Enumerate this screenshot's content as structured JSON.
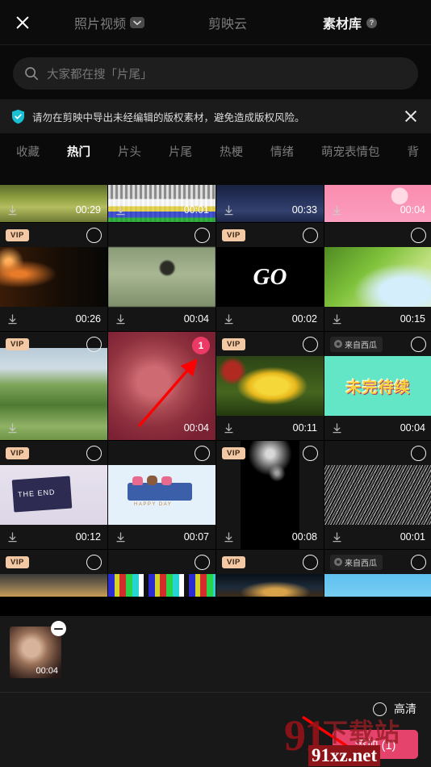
{
  "header": {
    "close_icon": "close-icon",
    "tabs": [
      {
        "label": "照片视频",
        "active": false,
        "has_chevron": true
      },
      {
        "label": "剪映云",
        "active": false,
        "has_chevron": false
      },
      {
        "label": "素材库",
        "active": true,
        "has_help": true,
        "help_glyph": "?"
      }
    ]
  },
  "search": {
    "placeholder": "大家都在搜「片尾」",
    "icon": "search-icon"
  },
  "banner": {
    "icon": "shield-check-icon",
    "text": "请勿在剪映中导出未经编辑的版权素材，避免造成版权风险。",
    "close_icon": "close-icon",
    "accent": "#19bfd3"
  },
  "categories": [
    {
      "label": "收藏",
      "active": false
    },
    {
      "label": "热门",
      "active": true
    },
    {
      "label": "片头",
      "active": false
    },
    {
      "label": "片尾",
      "active": false
    },
    {
      "label": "热梗",
      "active": false
    },
    {
      "label": "情绪",
      "active": false
    },
    {
      "label": "萌宠表情包",
      "active": false
    },
    {
      "label": "背",
      "active": false
    }
  ],
  "badges": {
    "vip": "VIP",
    "source": "来自西瓜"
  },
  "grid": {
    "row_clip_top": [
      {
        "duration": "00:29",
        "thumb": "forest-grass"
      },
      {
        "duration": "00:01",
        "thumb": "test-pattern"
      },
      {
        "duration": "00:33",
        "thumb": "ocean-water"
      },
      {
        "duration": "00:04",
        "thumb": "pink-blossom"
      }
    ],
    "rows": [
      [
        {
          "vip": true,
          "duration": "00:26",
          "thumb": "orange-sparkles",
          "selected": false
        },
        {
          "vip": false,
          "duration": "00:04",
          "thumb": "green-bell",
          "selected": false
        },
        {
          "vip": true,
          "duration": "00:02",
          "thumb": "go-text",
          "selected": false
        },
        {
          "vip": false,
          "duration": "00:15",
          "thumb": "tree-canopy",
          "selected": false
        }
      ],
      [
        {
          "vip": true,
          "duration": "",
          "thumb": "green-hills",
          "selected": false
        },
        {
          "vip": false,
          "duration": "00:04",
          "thumb": "man-portrait",
          "selected": true,
          "badge_number": "1"
        },
        {
          "vip": true,
          "duration": "00:11",
          "thumb": "yellow-flower",
          "selected": false
        },
        {
          "vip": false,
          "source": true,
          "duration": "00:04",
          "thumb": "weiwan-daixu",
          "selected": false
        }
      ],
      [
        {
          "vip": true,
          "duration": "00:12",
          "thumb": "the-end-clapper",
          "selected": false
        },
        {
          "vip": false,
          "duration": "00:07",
          "thumb": "thankyou-card",
          "selected": false
        },
        {
          "vip": true,
          "duration": "00:08",
          "thumb": "black-particles",
          "selected": false
        },
        {
          "vip": false,
          "duration": "00:01",
          "thumb": "tv-noise",
          "selected": false
        }
      ],
      [
        {
          "vip": true,
          "duration": "",
          "thumb": "sunset-sky",
          "selected": false
        },
        {
          "vip": false,
          "duration": "",
          "thumb": "color-bars",
          "selected": false
        },
        {
          "vip": true,
          "duration": "",
          "thumb": "city-night",
          "selected": false
        },
        {
          "vip": false,
          "source": true,
          "duration": "",
          "thumb": "birds-sky",
          "selected": false
        }
      ]
    ]
  },
  "selection_strip": {
    "items": [
      {
        "duration": "00:04",
        "thumb": "man-portrait",
        "remove_icon": "minus-circle-icon"
      }
    ]
  },
  "action_bar": {
    "hd_label": "高清",
    "hd_selected": false,
    "add_label": "添加 (1)",
    "accent": "#e5436b"
  },
  "watermark": {
    "brand_cn": "下载站",
    "brand_num": "91",
    "url": "91xz.net"
  }
}
